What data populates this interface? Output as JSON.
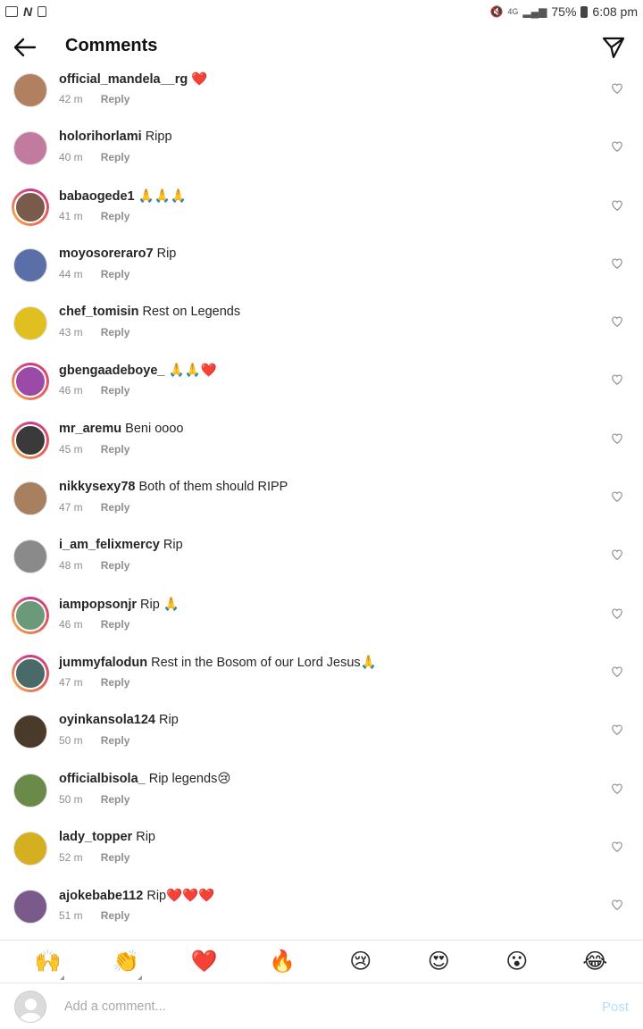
{
  "status_bar": {
    "battery": "75%",
    "time": "6:08 pm",
    "network": "4G",
    "icons": [
      "gallery-icon",
      "n-notification-icon",
      "alert-icon",
      "mute-icon",
      "signal-icon",
      "battery-icon"
    ]
  },
  "header": {
    "title": "Comments",
    "back_icon": "arrow-left-icon",
    "send_icon": "paper-plane-icon"
  },
  "comments": [
    {
      "username": "official_mandela__rg",
      "text": "❤️",
      "time": "42 m",
      "reply": "Reply",
      "story": false,
      "avatar_color": "#b08060"
    },
    {
      "username": "holorihorlami",
      "text": "Ripp",
      "time": "40 m",
      "reply": "Reply",
      "story": false,
      "avatar_color": "#c27a9e"
    },
    {
      "username": "babaogede1",
      "text": "🙏🙏🙏",
      "time": "41 m",
      "reply": "Reply",
      "story": true,
      "avatar_color": "#7a5a4a"
    },
    {
      "username": "moyosoreraro7",
      "text": "Rip",
      "time": "44 m",
      "reply": "Reply",
      "story": false,
      "avatar_color": "#5a6fa8"
    },
    {
      "username": "chef_tomisin",
      "text": "Rest on Legends",
      "time": "43 m",
      "reply": "Reply",
      "story": false,
      "avatar_color": "#e0c020"
    },
    {
      "username": "gbengaadeboye_",
      "text": "🙏🙏❤️",
      "time": "46 m",
      "reply": "Reply",
      "story": true,
      "avatar_color": "#9b4aa8"
    },
    {
      "username": "mr_aremu",
      "text": "Beni oooo",
      "time": "45 m",
      "reply": "Reply",
      "story": true,
      "avatar_color": "#3a3a3a"
    },
    {
      "username": "nikkysexy78",
      "text": "Both of them should RIPP",
      "time": "47 m",
      "reply": "Reply",
      "story": false,
      "avatar_color": "#a88060"
    },
    {
      "username": "i_am_felixmercy",
      "text": "Rip",
      "time": "48 m",
      "reply": "Reply",
      "story": false,
      "avatar_color": "#8a8a8a"
    },
    {
      "username": "iampopsonjr",
      "text": "Rip 🙏",
      "time": "46 m",
      "reply": "Reply",
      "story": true,
      "avatar_color": "#6a9a7a"
    },
    {
      "username": "jummyfalodun",
      "text": "Rest in the Bosom of our Lord Jesus🙏",
      "time": "47 m",
      "reply": "Reply",
      "story": true,
      "avatar_color": "#4a6a6a"
    },
    {
      "username": "oyinkansola124",
      "text": "Rip",
      "time": "50 m",
      "reply": "Reply",
      "story": false,
      "avatar_color": "#4a3a2a"
    },
    {
      "username": "officialbisola_",
      "text": "Rip legends😢",
      "time": "50 m",
      "reply": "Reply",
      "story": false,
      "avatar_color": "#6a8a4a"
    },
    {
      "username": "lady_topper",
      "text": "Rip",
      "time": "52 m",
      "reply": "Reply",
      "story": false,
      "avatar_color": "#d4b020"
    },
    {
      "username": "ajokebabe112",
      "text": "Rip❤️❤️❤️",
      "time": "51 m",
      "reply": "Reply",
      "story": false,
      "avatar_color": "#7a5a8a"
    }
  ],
  "emoji_bar": [
    {
      "glyph": "🙌",
      "corner": true
    },
    {
      "glyph": "👏",
      "corner": true
    },
    {
      "glyph": "❤️",
      "corner": false
    },
    {
      "glyph": "🔥",
      "corner": false
    },
    {
      "glyph": "😢",
      "corner": false
    },
    {
      "glyph": "😍",
      "corner": false
    },
    {
      "glyph": "😮",
      "corner": false
    },
    {
      "glyph": "😂",
      "corner": false
    }
  ],
  "input": {
    "placeholder": "Add a comment...",
    "post_label": "Post"
  },
  "colors": {
    "post_disabled": "#b2dffc",
    "meta_gray": "#8e8e8e",
    "story_ring_start": "#c8398a",
    "story_ring_end": "#f4a24a"
  }
}
